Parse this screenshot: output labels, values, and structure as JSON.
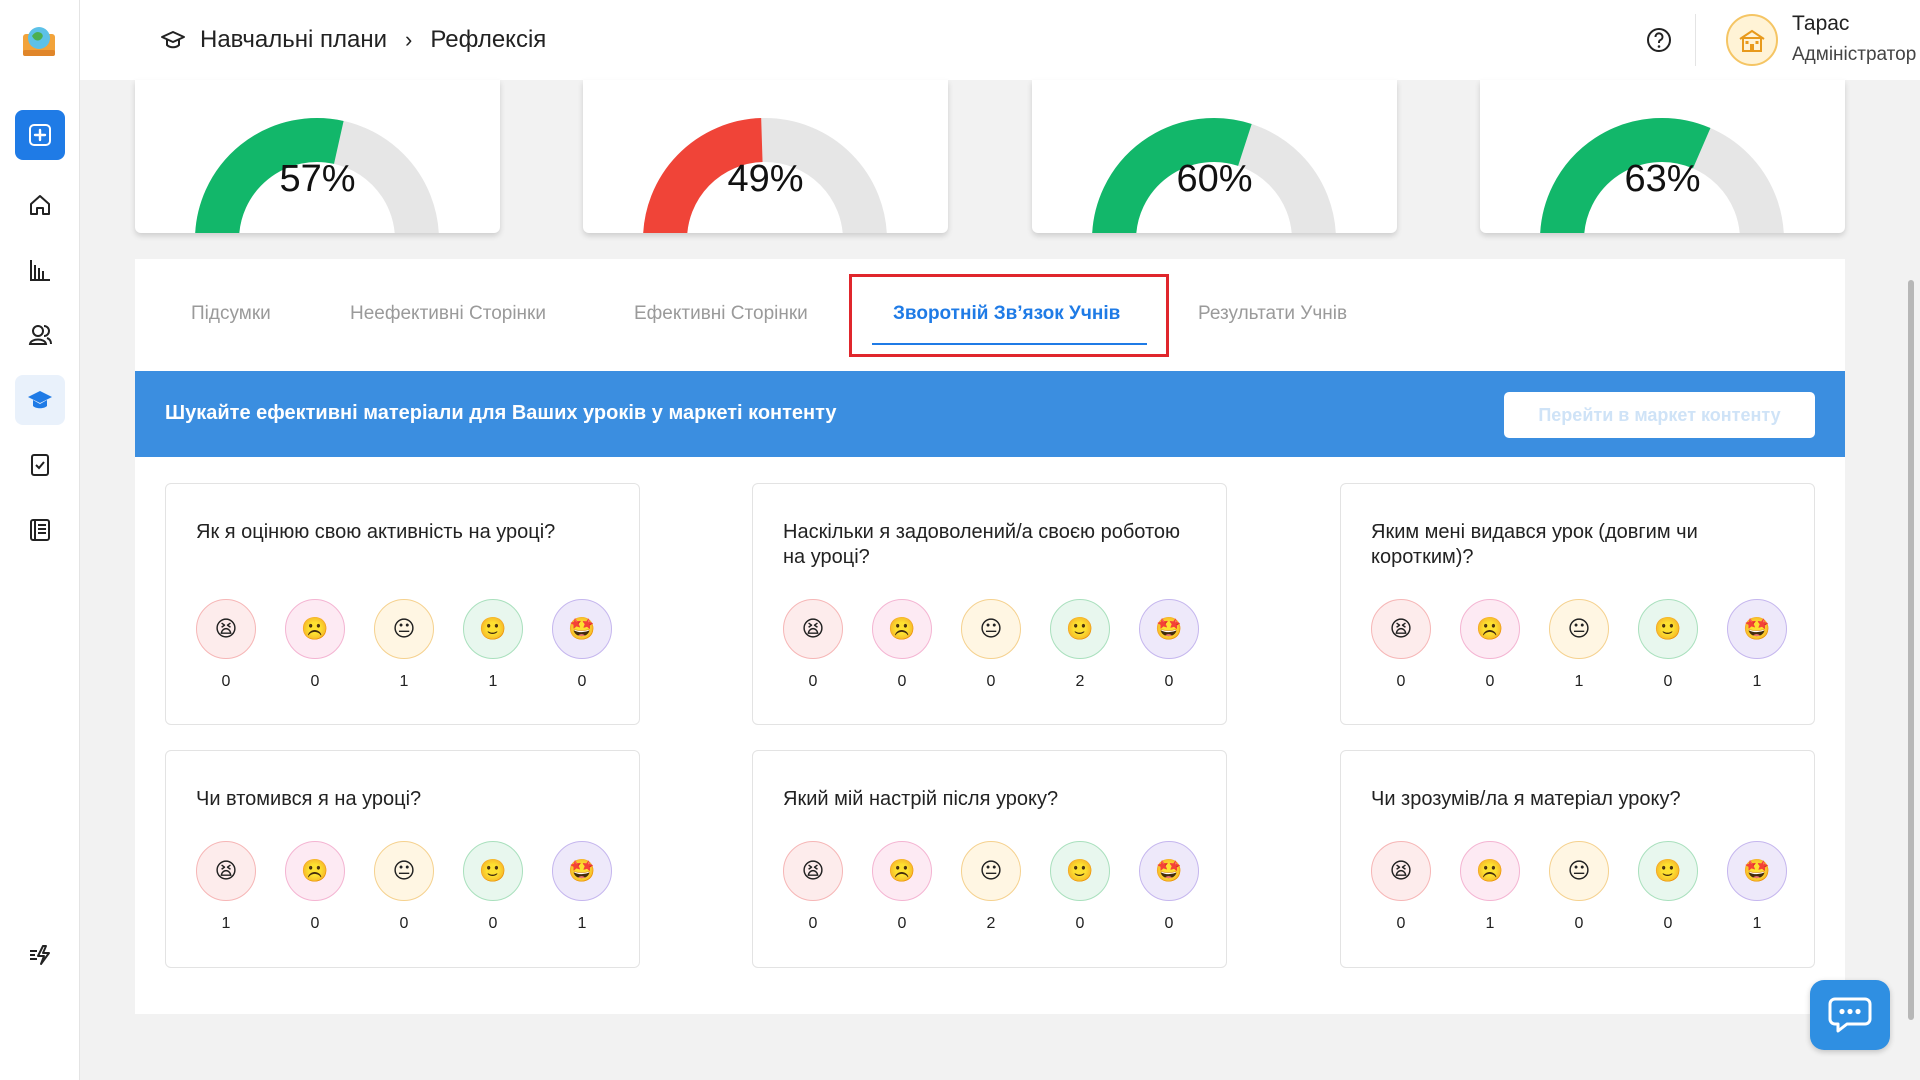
{
  "header": {
    "breadcrumb": [
      "Навчальні плани",
      "Рефлексія"
    ],
    "separator": "›",
    "user_name": "Тарас",
    "user_role": "Адміністратор"
  },
  "gauges": [
    {
      "value": 57,
      "label": "57%",
      "color": "#12b76a"
    },
    {
      "value": 49,
      "label": "49%",
      "color": "#f04438"
    },
    {
      "value": 60,
      "label": "60%",
      "color": "#12b76a"
    },
    {
      "value": 63,
      "label": "63%",
      "color": "#12b76a"
    }
  ],
  "tabs": [
    {
      "label": "Підсумки",
      "active": false
    },
    {
      "label": "Неефективні Сторінки",
      "active": false
    },
    {
      "label": "Ефективні Сторінки",
      "active": false
    },
    {
      "label": "Зворотній Зв’язок Учнів",
      "active": true
    },
    {
      "label": "Результати Учнів",
      "active": false
    }
  ],
  "banner": {
    "text": "Шукайте ефективні матеріали для Ваших уроків у маркеті контенту",
    "button_label": "Перейти в маркет контенту"
  },
  "faces": [
    "😫",
    "☹️",
    "😐",
    "🙂",
    "🤩"
  ],
  "questions": [
    {
      "title": "Як я оцінюю свою активність на уроці?",
      "counts": [
        "0",
        "0",
        "1",
        "1",
        "0"
      ]
    },
    {
      "title": "Наскільки я задоволений/а своєю роботою на уроці?",
      "counts": [
        "0",
        "0",
        "0",
        "2",
        "0"
      ]
    },
    {
      "title": "Яким мені видався урок (довгим чи коротким)?",
      "counts": [
        "0",
        "0",
        "1",
        "0",
        "1"
      ]
    },
    {
      "title": "Чи втомився я на уроці?",
      "counts": [
        "1",
        "0",
        "0",
        "0",
        "1"
      ]
    },
    {
      "title": "Який мій настрій після уроку?",
      "counts": [
        "0",
        "0",
        "2",
        "0",
        "0"
      ]
    },
    {
      "title": "Чи зрозумів/ла я матеріал уроку?",
      "counts": [
        "0",
        "1",
        "0",
        "0",
        "1"
      ]
    }
  ]
}
